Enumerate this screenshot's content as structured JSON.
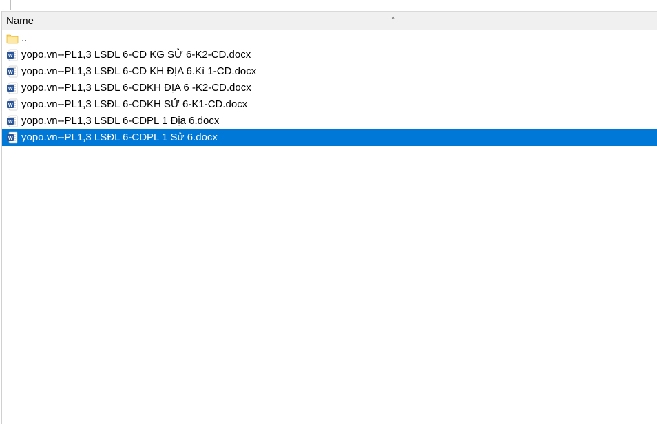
{
  "header": {
    "column_name": "Name",
    "sort_indicator": "˄"
  },
  "items": [
    {
      "type": "folder",
      "name": "..",
      "selected": false
    },
    {
      "type": "docx",
      "name": "yopo.vn--PL1,3 LSĐL 6-CD KG SỬ 6-K2-CD.docx",
      "selected": false
    },
    {
      "type": "docx",
      "name": "yopo.vn--PL1,3 LSĐL 6-CD KH ĐỊA 6.Kì 1-CD.docx",
      "selected": false
    },
    {
      "type": "docx",
      "name": "yopo.vn--PL1,3 LSĐL 6-CDKH ĐỊA 6 -K2-CD.docx",
      "selected": false
    },
    {
      "type": "docx",
      "name": "yopo.vn--PL1,3 LSĐL 6-CDKH SỬ 6-K1-CD.docx",
      "selected": false
    },
    {
      "type": "docx",
      "name": "yopo.vn--PL1,3 LSĐL 6-CDPL 1 Địa 6.docx",
      "selected": false
    },
    {
      "type": "docx",
      "name": "yopo.vn--PL1,3 LSĐL 6-CDPL 1 Sử 6.docx",
      "selected": true
    }
  ],
  "icons": {
    "folder": "folder-icon",
    "docx": "word-doc-icon"
  }
}
